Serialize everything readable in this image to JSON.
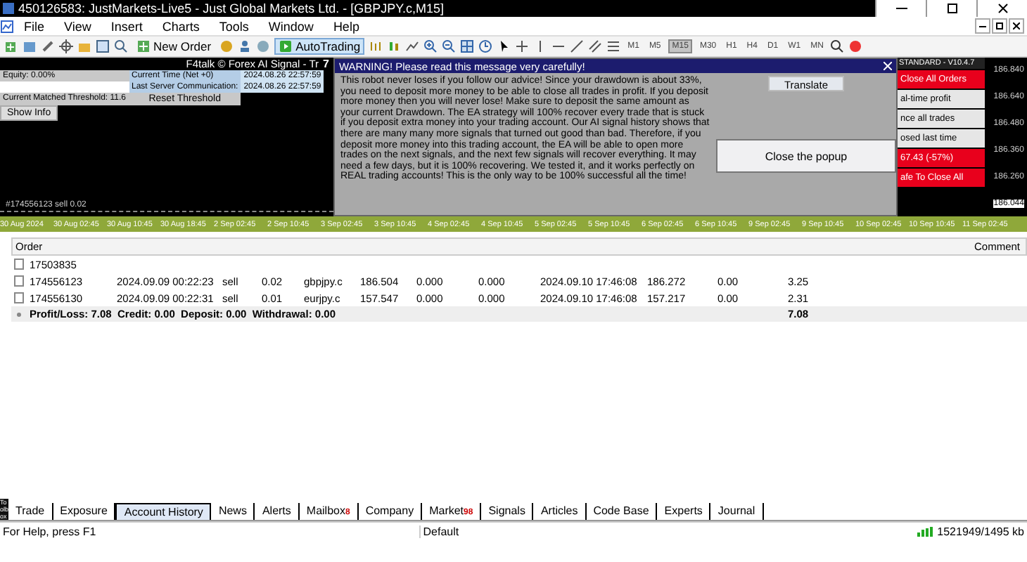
{
  "window": {
    "title": "45012658​3: JustMarkets-Live5 - Just Global Markets Ltd. - [GBPJPY.c,M15]"
  },
  "menu": [
    "File",
    "View",
    "Insert",
    "Charts",
    "Tools",
    "Window",
    "Help"
  ],
  "toolbar": {
    "new_order": "New Order",
    "autotrading": {
      "label": "AutoTrading",
      "on": true
    },
    "timeframes": [
      {
        "label": "M1",
        "selected": false
      },
      {
        "label": "M5",
        "selected": false
      },
      {
        "label": "M15",
        "selected": true
      },
      {
        "label": "M30",
        "selected": false
      },
      {
        "label": "H1",
        "selected": false
      },
      {
        "label": "H4",
        "selected": false
      },
      {
        "label": "D1",
        "selected": false
      },
      {
        "label": "W1",
        "selected": false
      },
      {
        "label": "MN",
        "selected": false
      }
    ]
  },
  "chart": {
    "header": "F4talk © Forex AI Signal - Tr",
    "marker": "7",
    "info_panel": {
      "equity": "Equity: 0.00%",
      "threshold": "Current Matched Threshold: 11.6",
      "show_info": "Show Info",
      "current_time_label": "Current Time (Net +0)",
      "current_time": "2024.08.26 22:57:59",
      "server_label": "Last Server Communication:",
      "server_time": "2024.08.26 22:57:59",
      "reset": "Reset Threshold"
    },
    "order_line": "#174556123 sell 0.02",
    "popup": {
      "title": "WARNING! Please read this message very carefully!",
      "body": "This robot never loses if you follow our advice! Since your drawdown is about 33%, you need to deposit more money to be able to close all trades in profit. If you deposit more money then you will never lose! Make sure to deposit the same amount as your current Drawdown. The EA strategy will 100% recover every trade that is stuck if you deposit extra money into your trading account. Our AI signal history shows that there are many many more signals that turned out good than bad. Therefore, if you deposit more money into this trading account, the EA will be able to open more trades on the next signals, and the next few signals will recover everything. It may need a few days, but it is 100% recovering. We tested it, and it works perfectly on REAL trading accounts! This is the only way to be 100% successful all the time!",
      "translate": "Translate",
      "close": "Close the popup"
    },
    "panel": {
      "header": "STANDARD - V10.4.7",
      "buttons": [
        {
          "label": "Close All Orders",
          "kind": "alert"
        },
        {
          "label": "al-time profit",
          "kind": "plain"
        },
        {
          "label": "nce all trades",
          "kind": "plain"
        },
        {
          "label": "osed last time",
          "kind": "plain"
        },
        {
          "label": "67.43 (-57%)",
          "kind": "alert"
        },
        {
          "label": "afe To Close All",
          "kind": "alert"
        }
      ]
    },
    "prices": [
      {
        "label": "186.840",
        "current": false
      },
      {
        "label": "186.640",
        "current": false
      },
      {
        "label": "186.480",
        "current": false
      },
      {
        "label": "186.360",
        "current": false
      },
      {
        "label": "186.260",
        "current": false
      },
      {
        "label": "186.044",
        "current": true
      }
    ],
    "time_axis": [
      "30 Aug 2024",
      "30 Aug 02:45",
      "30 Aug 10:45",
      "30 Aug 18:45",
      "2 Sep 02:45",
      "2 Sep 10:45",
      "3 Sep 02:45",
      "3 Sep 10:45",
      "4 Sep 02:45",
      "4 Sep 10:45",
      "5 Sep 02:45",
      "5 Sep 10:45",
      "6 Sep 02:45",
      "6 Sep 10:45",
      "9 Sep 02:45",
      "9 Sep 10:45",
      "10 Sep 02:45",
      "10 Sep 10:45",
      "11 Sep 02:45"
    ]
  },
  "table": {
    "columns": [
      "Order",
      "Comment"
    ],
    "rows": [
      {
        "cells": [
          "17503835"
        ]
      },
      {
        "cells": [
          "174556123",
          "2024.09.09 00:22:23",
          "sell",
          "0.02",
          "gbpjpy.c",
          "186.504",
          "0.000",
          "0.000",
          "2024.09.10 17:46:08",
          "186.272",
          "0.00",
          "3.25"
        ]
      },
      {
        "cells": [
          "174556130",
          "2024.09.09 00:22:31",
          "sell",
          "0.01",
          "eurjpy.c",
          "157.547",
          "0.000",
          "0.000",
          "2024.09.10 17:46:08",
          "157.217",
          "0.00",
          "2.31"
        ]
      }
    ],
    "summary": {
      "text": "Profit/Loss: 7.08  Credit: 0.00  Deposit: 0.00  Withdrawal: 0.00",
      "total": "7.08"
    }
  },
  "toolbox_label": "Toolbox",
  "tabs": [
    {
      "label": "Trade",
      "selected": false
    },
    {
      "label": "Exposure",
      "selected": false
    },
    {
      "label": "Account History",
      "selected": true
    },
    {
      "label": "News",
      "selected": false
    },
    {
      "label": "Alerts",
      "selected": false
    },
    {
      "label": "Mailbox",
      "badge": "8",
      "selected": false
    },
    {
      "label": "Company",
      "selected": false
    },
    {
      "label": "Market",
      "badge": "98",
      "selected": false
    },
    {
      "label": "Signals",
      "selected": false
    },
    {
      "label": "Articles",
      "selected": false
    },
    {
      "label": "Code Base",
      "selected": false
    },
    {
      "label": "Experts",
      "selected": false
    },
    {
      "label": "Journal",
      "selected": false
    }
  ],
  "status_bar": {
    "help": "For Help, press F1",
    "profile": "Default",
    "traffic": "1521949/1495 kb"
  }
}
